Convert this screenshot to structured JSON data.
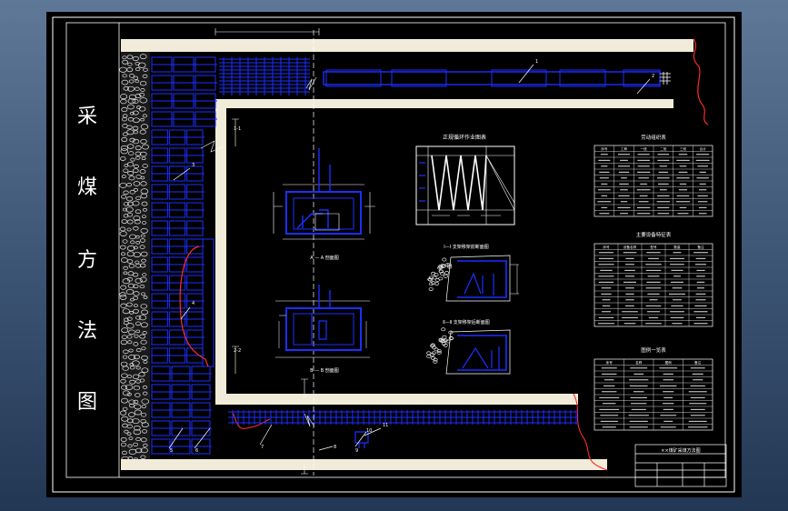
{
  "drawing": {
    "title_chars": [
      "采",
      "煤",
      "方",
      "法",
      "图"
    ],
    "section_labels": {
      "top_left": "1-1",
      "mid_left": "2-2"
    },
    "panel_titles": {
      "cycle_chart": "正规循环作业图表",
      "section_a": "A — A 剖面图",
      "section_b": "B — B 剖面图",
      "advance_1": "Ⅰ—Ⅰ 支架移架前断面图",
      "advance_2": "Ⅱ—Ⅱ 支架移架后断面图",
      "table_labor": "劳动组织表",
      "table_equipment": "主要设备特征表",
      "table_legend": "图例一览表",
      "title_block": "××煤矿采煤方法图"
    },
    "table_headers": {
      "labor": [
        "序号",
        "工种",
        "一班",
        "二班",
        "三班",
        "合计"
      ],
      "equipment": [
        "序号",
        "设备名称",
        "型号",
        "数量",
        "备注"
      ],
      "legend": [
        "序号",
        "名称",
        "图例",
        "备注"
      ]
    },
    "callouts": [
      "1",
      "2",
      "3",
      "4",
      "5",
      "6",
      "7",
      "8",
      "9",
      "10",
      "11"
    ]
  },
  "colors": {
    "background": "#000000",
    "roadway": "#f1ecd9",
    "equipment": "#1b2fff",
    "coal_boundary": "#ff2a2a",
    "lines": "#ffffff",
    "window_frame": "#4a6384"
  }
}
